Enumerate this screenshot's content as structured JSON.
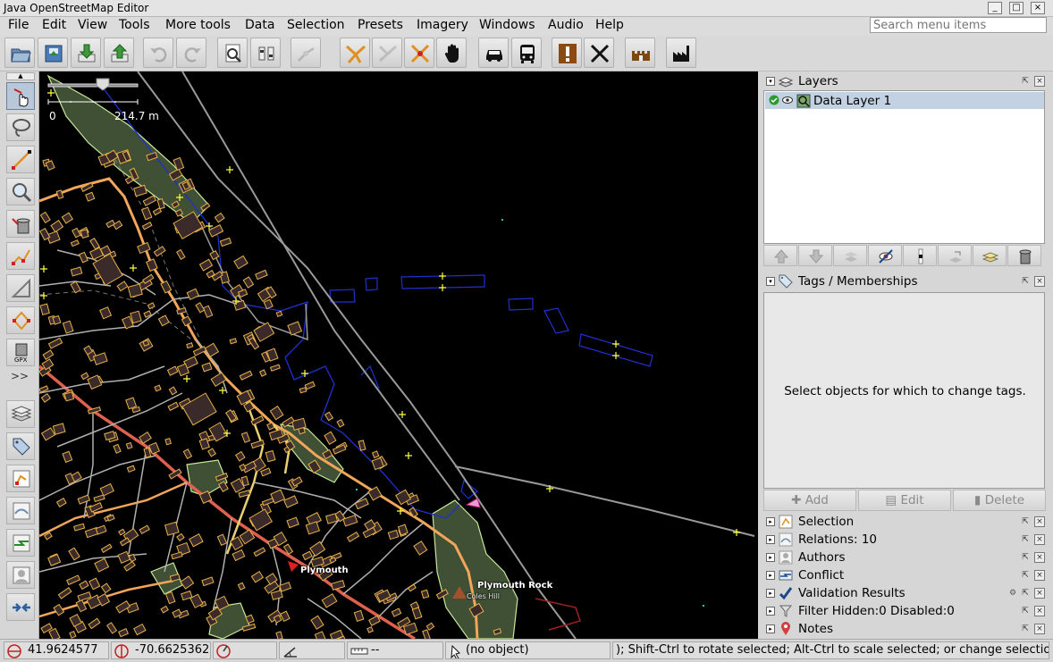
{
  "window": {
    "title": "Java OpenStreetMap Editor"
  },
  "menu": {
    "items": [
      "File",
      "Edit",
      "View",
      "Tools",
      "More tools",
      "Data",
      "Selection",
      "Presets",
      "Imagery",
      "Windows",
      "Audio",
      "Help"
    ],
    "search_placeholder": "Search menu items"
  },
  "map": {
    "scale_zero": "0",
    "scale_length": "214.7 m",
    "labels": {
      "town": "Plymouth",
      "rock": "Plymouth Rock",
      "hill": "Coles Hill"
    }
  },
  "layers_panel": {
    "title": "Layers",
    "layer_name": "Data Layer 1"
  },
  "tags_panel": {
    "title": "Tags / Memberships",
    "empty_message": "Select objects for which to change tags.",
    "add_label": "Add",
    "edit_label": "Edit",
    "delete_label": "Delete"
  },
  "collapsed_panels": [
    "Selection",
    "Relations: 10",
    "Authors",
    "Conflict",
    "Validation Results",
    "Filter Hidden:0 Disabled:0",
    "Notes"
  ],
  "status": {
    "lat": "41.9624577",
    "lon": "-70.6625362",
    "angle": "",
    "heading": "",
    "distance": "--",
    "object": "(no object)",
    "help": "); Shift-Ctrl to rotate selected; Alt-Ctrl to scale selected; or change selection"
  },
  "colors": {
    "map_bg": "#000000",
    "selection_row": "#c2d2e2",
    "building_outline": "#e8b04a",
    "highway_primary": "#f2a65a",
    "highway_secondary": "#e8d070",
    "road": "#b0b0b0",
    "wood_fill": "#3f5035",
    "park_fill": "#c8e89a"
  }
}
